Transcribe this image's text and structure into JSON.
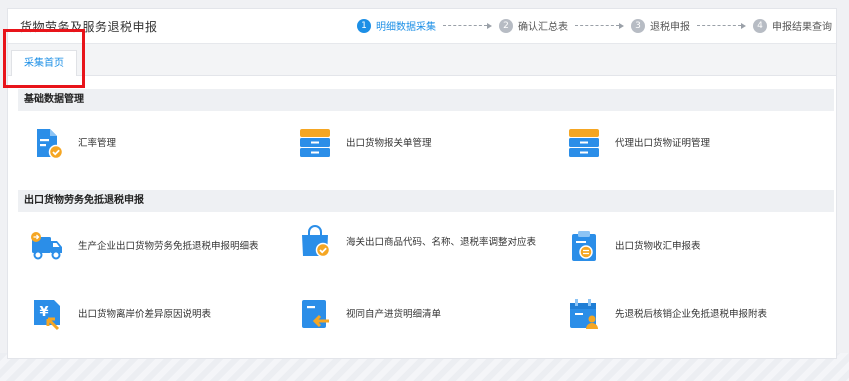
{
  "header": {
    "title": "货物劳务及服务退税申报",
    "steps": [
      {
        "num": "1",
        "label": "明细数据采集",
        "active": true
      },
      {
        "num": "2",
        "label": "确认汇总表",
        "active": false
      },
      {
        "num": "3",
        "label": "退税申报",
        "active": false
      },
      {
        "num": "4",
        "label": "申报结果查询",
        "active": false
      }
    ]
  },
  "tabs": [
    {
      "label": "采集首页",
      "active": true
    }
  ],
  "sections": [
    {
      "title": "基础数据管理",
      "items": [
        {
          "label": "汇率管理",
          "icon": "document-check-icon"
        },
        {
          "label": "出口货物报关单管理",
          "icon": "cabinet-icon"
        },
        {
          "label": "代理出口货物证明管理",
          "icon": "cabinet-icon"
        }
      ]
    },
    {
      "title": "出口货物劳务免抵退税申报",
      "items": [
        {
          "label": "生产企业出口货物劳务免抵退税申报明细表",
          "icon": "delivery-truck-icon"
        },
        {
          "label": "海关出口商品代码、名称、退税率调整对应表",
          "icon": "shopping-bag-check-icon"
        },
        {
          "label": "出口货物收汇申报表",
          "icon": "clipboard-exchange-icon"
        },
        {
          "label": "出口货物离岸价差异原因说明表",
          "icon": "yen-arrow-icon"
        },
        {
          "label": "视同自产进货明细清单",
          "icon": "document-return-icon"
        },
        {
          "label": "先退税后核销企业免抵退税申报附表",
          "icon": "calendar-user-icon"
        }
      ]
    }
  ],
  "colors": {
    "accent": "#1c8fe6",
    "icon_blue": "#2b8ee8",
    "icon_orange": "#f5a623",
    "highlight_red": "#e8141a"
  }
}
